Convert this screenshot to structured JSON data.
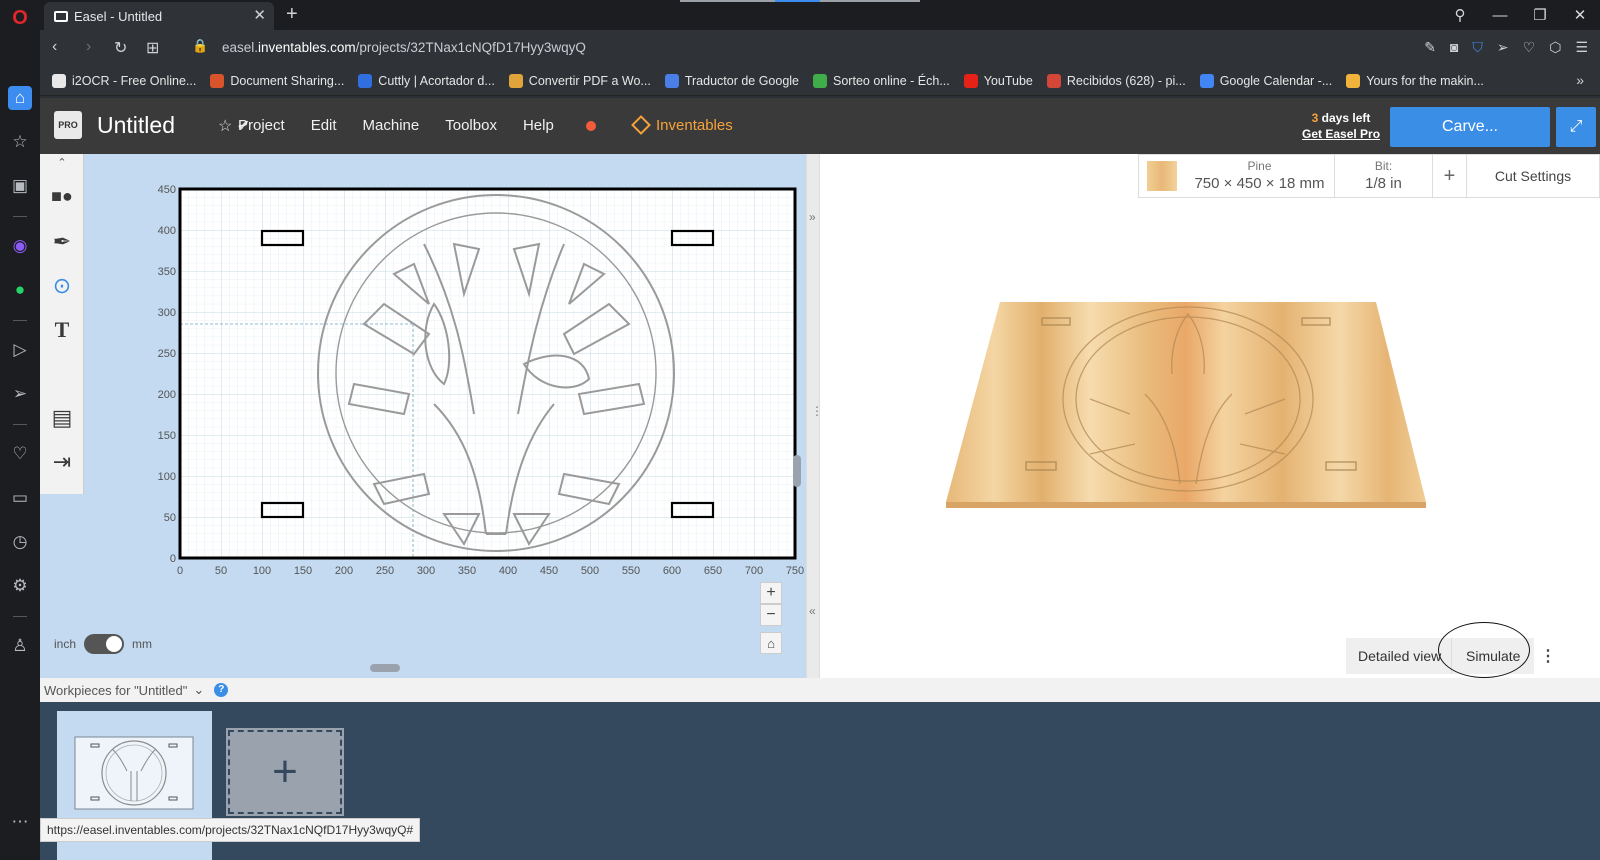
{
  "browser": {
    "tab_title": "Easel - Untitled",
    "url_prefix": "easel.",
    "url_domain": "inventables.com",
    "url_path": "/projects/32TNax1cNQfD17Hyy3wqyQ",
    "status_url": "https://easel.inventables.com/projects/32TNax1cNQfD17Hyy3wqyQ#"
  },
  "bookmarks": [
    {
      "label": "i2OCR - Free Online...",
      "color": "#e8e8e8"
    },
    {
      "label": "Document Sharing...",
      "color": "#d9542b"
    },
    {
      "label": "Cuttly | Acortador d...",
      "color": "#2f6fe0"
    },
    {
      "label": "Convertir PDF a Wo...",
      "color": "#e0a43b"
    },
    {
      "label": "Traductor de Google",
      "color": "#4a7fe8"
    },
    {
      "label": "Sorteo online - Éch...",
      "color": "#3fae4a"
    },
    {
      "label": "YouTube",
      "color": "#e62117"
    },
    {
      "label": "Recibidos (628) - pi...",
      "color": "#d44638"
    },
    {
      "label": "Google Calendar -...",
      "color": "#4285f4"
    },
    {
      "label": "Yours for the makin...",
      "color": "#f2b33d"
    }
  ],
  "header": {
    "logo": "PRO",
    "project_title": "Untitled",
    "menu": {
      "project": "Project",
      "edit": "Edit",
      "machine": "Machine",
      "toolbox": "Toolbox",
      "help": "Help"
    },
    "brand": "Inventables",
    "trial_days": "3",
    "trial_days_suffix": " days left",
    "get_pro": "Get Easel Pro",
    "carve": "Carve..."
  },
  "canvas": {
    "y_ticks": [
      "450",
      "400",
      "350",
      "300",
      "250",
      "200",
      "150",
      "100",
      "50",
      "0"
    ],
    "x_ticks": [
      "0",
      "50",
      "100",
      "150",
      "200",
      "250",
      "300",
      "350",
      "400",
      "450",
      "500",
      "550",
      "600",
      "650",
      "700",
      "750"
    ],
    "unit_inch": "inch",
    "unit_mm": "mm"
  },
  "material": {
    "name": "Pine",
    "dims": "750 × 450 × 18 mm",
    "bit_label": "Bit:",
    "bit_value": "1/8 in",
    "cut_settings": "Cut Settings"
  },
  "preview": {
    "detailed_view": "Detailed view",
    "simulate": "Simulate"
  },
  "workpieces": {
    "title": "Workpieces for \"Untitled\"",
    "help": "?"
  },
  "colors": {
    "accent_blue": "#3b8ee6",
    "brand_orange": "#f6a33b",
    "canvas_bg": "#c3daf1",
    "workpiece_bg": "#34495e"
  }
}
